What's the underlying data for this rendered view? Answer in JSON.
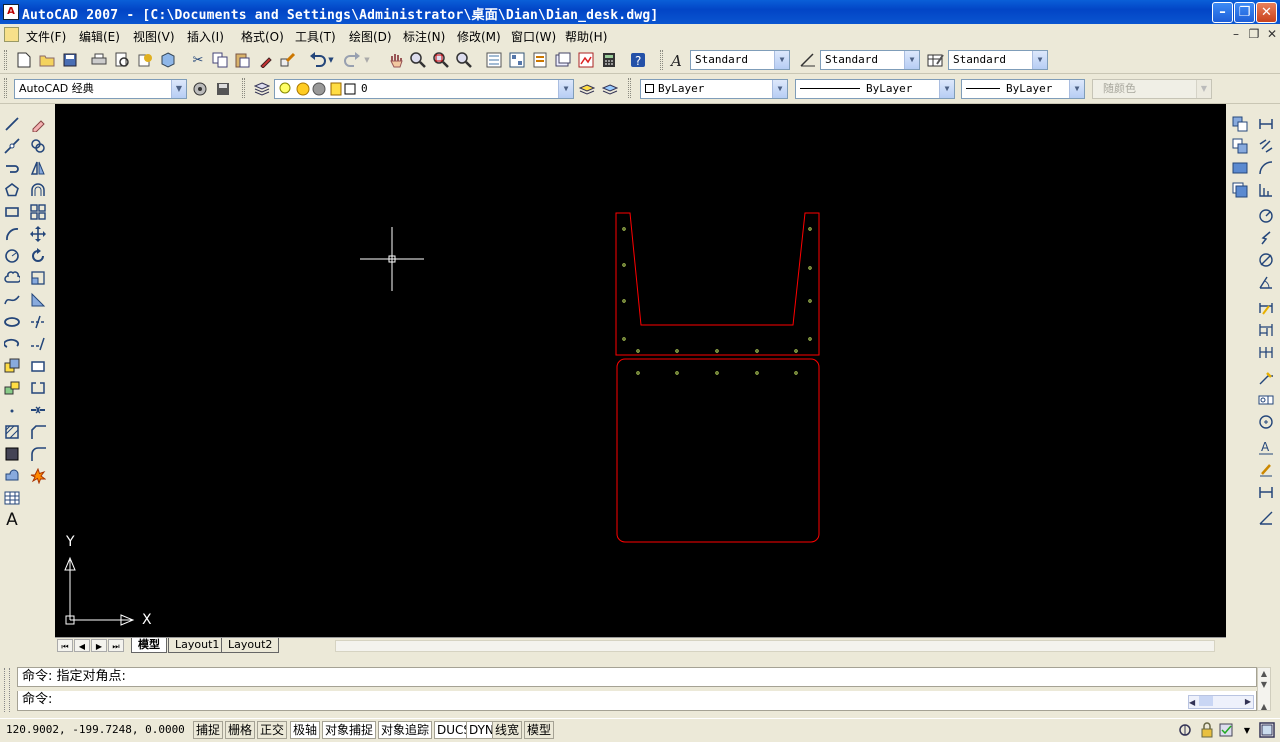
{
  "window": {
    "title": "AutoCAD 2007 - [C:\\Documents and Settings\\Administrator\\桌面\\Dian\\Dian_desk.dwg]",
    "app_icon_text": "A"
  },
  "menu": {
    "items": [
      "文件(F)",
      "编辑(E)",
      "视图(V)",
      "插入(I)",
      "格式(O)",
      "工具(T)",
      "绘图(D)",
      "标注(N)",
      "修改(M)",
      "窗口(W)",
      "帮助(H)"
    ]
  },
  "toolbar_styles": {
    "text_style": "Standard",
    "dim_style": "Standard",
    "table_style": "Standard"
  },
  "toolbar_workspace": {
    "workspace": "AutoCAD 经典",
    "layer": "0"
  },
  "toolbar_properties": {
    "color": "ByLayer",
    "linetype": "ByLayer",
    "lineweight": "ByLayer",
    "plot_style": "随颜色"
  },
  "ucs": {
    "x_label": "X",
    "y_label": "Y"
  },
  "layout_tabs": [
    "模型",
    "Layout1",
    "Layout2"
  ],
  "command": {
    "history_line": "命令: 指定对角点:",
    "prompt_line": "命令:"
  },
  "status": {
    "coords": "120.9002,  -199.7248, 0.0000",
    "toggles": [
      "捕捉",
      "栅格",
      "正交",
      "极轴",
      "对象捕捉",
      "对象追踪",
      "DUCS",
      "DYN",
      "线宽",
      "模型"
    ],
    "on_toggles": [
      "极轴",
      "对象捕捉",
      "对象追踪",
      "DUCS",
      "DYN"
    ]
  },
  "colors": {
    "drawing_bg": "#000000",
    "outline": "#ff0000",
    "points": "#b8d45a",
    "crosshair": "#ffffff",
    "title_bar": "#0a5fd8"
  },
  "icons": {
    "standard_toolbar": [
      "new-icon",
      "open-icon",
      "save-icon",
      "plot-icon",
      "plot-preview-icon",
      "publish-icon",
      "3d-dwf-icon",
      "cut-icon",
      "copy-icon",
      "paste-icon",
      "match-properties-icon",
      "block-editor-icon",
      "undo-icon",
      "redo-icon",
      "pan-icon",
      "zoom-realtime-icon",
      "zoom-window-icon",
      "zoom-previous-icon",
      "properties-icon",
      "design-center-icon",
      "tool-palettes-icon",
      "sheet-set-icon",
      "markup-icon",
      "quickcalc-icon",
      "help-icon"
    ],
    "draw_toolbar": [
      "line-icon",
      "construction-line-icon",
      "polyline-icon",
      "polygon-icon",
      "rectangle-icon",
      "arc-icon",
      "circle-icon",
      "revision-cloud-icon",
      "spline-icon",
      "ellipse-icon",
      "ellipse-arc-icon",
      "insert-block-icon",
      "make-block-icon",
      "point-icon",
      "hatch-icon",
      "gradient-icon",
      "region-icon",
      "table-icon",
      "multiline-text-icon"
    ],
    "modify_toolbar": [
      "erase-icon",
      "copy-object-icon",
      "mirror-icon",
      "offset-icon",
      "array-icon",
      "move-icon",
      "rotate-icon",
      "scale-icon",
      "stretch-icon",
      "trim-icon",
      "extend-icon",
      "break-at-point-icon",
      "break-icon",
      "join-icon",
      "chamfer-icon",
      "fillet-icon",
      "explode-icon"
    ],
    "draworder_toolbar": [
      "bring-to-front-icon",
      "send-to-back-icon",
      "bring-above-icon",
      "send-under-icon"
    ],
    "dimension_toolbar": [
      "linear-dim-icon",
      "aligned-dim-icon",
      "arc-length-icon",
      "ordinate-dim-icon",
      "radius-dim-icon",
      "jogged-dim-icon",
      "diameter-dim-icon",
      "angular-dim-icon",
      "quick-dim-icon",
      "baseline-dim-icon",
      "continue-dim-icon",
      "quick-leader-icon",
      "tolerance-icon",
      "center-mark-icon",
      "dim-edit-icon",
      "dim-text-edit-icon",
      "dim-update-icon",
      "dim-style-icon"
    ]
  }
}
